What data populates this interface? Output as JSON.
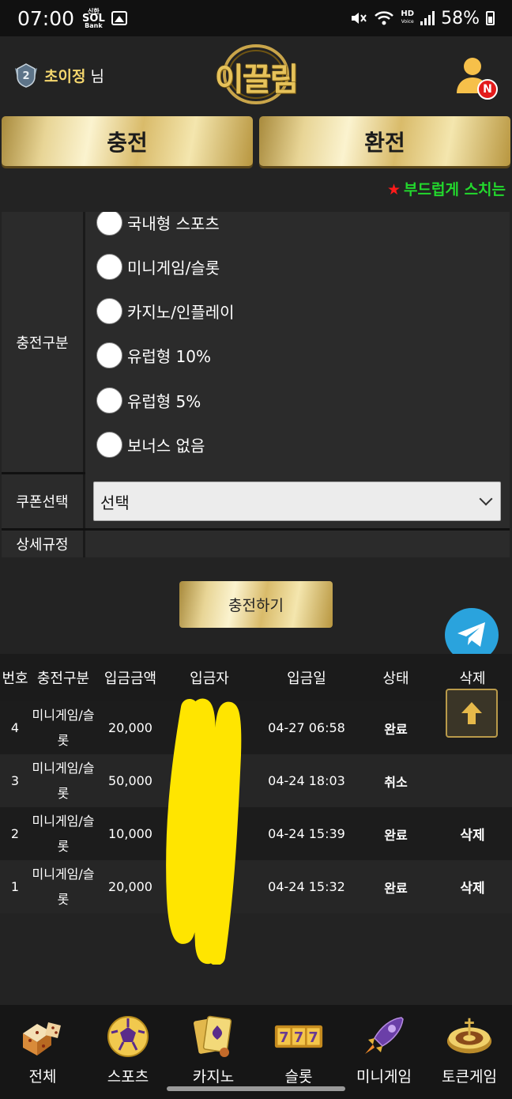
{
  "status_bar": {
    "time": "07:00",
    "sol_small": "신한",
    "sol_main": "SOL",
    "sol_bank": "Bank",
    "hd_label": "HD",
    "hd_sub": "Voice",
    "battery": "58%"
  },
  "header": {
    "username": "초이정",
    "username_suffix": "님",
    "logo_text": "이끌림",
    "notification_badge": "N"
  },
  "actions": {
    "charge_label": "충전",
    "exchange_label": "환전"
  },
  "marquee_text": "부드럽게 스치는",
  "form": {
    "type_label": "충전구분",
    "options": [
      "국내형 스포츠",
      "미니게임/슬롯",
      "카지노/인플레이",
      "유럽형 10%",
      "유럽형 5%",
      "보너스 없음"
    ],
    "coupon_label": "쿠폰선택",
    "coupon_value": "선택",
    "rules_label": "상세규정",
    "submit_label": "충전하기"
  },
  "history": {
    "headers": [
      "번호",
      "충전구분",
      "입금금액",
      "입금자",
      "입금일",
      "상태",
      "삭제"
    ],
    "rows": [
      {
        "no": "4",
        "type_line1": "미니게임/슬",
        "type_line2": "롯",
        "amount": "20,000",
        "depositor": "",
        "date": "04-27 06:58",
        "status": "완료",
        "delete": ""
      },
      {
        "no": "3",
        "type_line1": "미니게임/슬",
        "type_line2": "롯",
        "amount": "50,000",
        "depositor": "",
        "date": "04-24 18:03",
        "status": "취소",
        "delete": ""
      },
      {
        "no": "2",
        "type_line1": "미니게임/슬",
        "type_line2": "롯",
        "amount": "10,000",
        "depositor": "",
        "date": "04-24 15:39",
        "status": "완료",
        "delete": "삭제"
      },
      {
        "no": "1",
        "type_line1": "미니게임/슬",
        "type_line2": "롯",
        "amount": "20,000",
        "depositor": "",
        "date": "04-24 15:32",
        "status": "완료",
        "delete": "삭제"
      }
    ]
  },
  "bottom_nav": [
    {
      "label": "전체",
      "icon": "dice-icon"
    },
    {
      "label": "스포츠",
      "icon": "soccer-ball-icon"
    },
    {
      "label": "카지노",
      "icon": "playing-cards-icon"
    },
    {
      "label": "슬롯",
      "icon": "slot-777-icon"
    },
    {
      "label": "미니게임",
      "icon": "rocket-icon"
    },
    {
      "label": "토큰게임",
      "icon": "roulette-icon"
    }
  ],
  "colors": {
    "gold_accent": "#e8d596",
    "marquee_green": "#23d82d",
    "star_red": "#ff1a1a",
    "telegram_blue": "#2aa3dd",
    "background": "#232323"
  }
}
